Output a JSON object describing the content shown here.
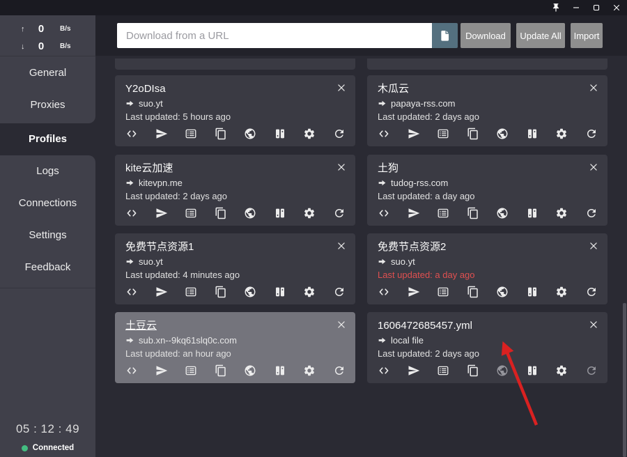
{
  "titlebar": {
    "controls": [
      "pin",
      "minimize",
      "maximize",
      "close"
    ]
  },
  "traffic": {
    "up": {
      "value": "0",
      "unit": "B/s"
    },
    "down": {
      "value": "0",
      "unit": "B/s"
    }
  },
  "toolbar": {
    "url_placeholder": "Download from a URL",
    "download_label": "Download",
    "update_all_label": "Update All",
    "import_label": "Import"
  },
  "sidebar": {
    "items": [
      "General",
      "Proxies",
      "Profiles",
      "Logs",
      "Connections",
      "Settings",
      "Feedback"
    ],
    "active_item": "Profiles",
    "timer": "05 : 12 : 49",
    "status_label": "Connected"
  },
  "profiles": [
    {
      "name": "Y2oDIsa",
      "source": "suo.yt",
      "updated": "Last updated: 5 hours ago",
      "stale": false,
      "selected": false,
      "local": false
    },
    {
      "name": "木瓜云",
      "source": "papaya-rss.com",
      "updated": "Last updated: 2 days ago",
      "stale": false,
      "selected": false,
      "local": false
    },
    {
      "name": "kite云加速",
      "source": "kitevpn.me",
      "updated": "Last updated: 2 days ago",
      "stale": false,
      "selected": false,
      "local": false
    },
    {
      "name": "土狗",
      "source": "tudog-rss.com",
      "updated": "Last updated: a day ago",
      "stale": false,
      "selected": false,
      "local": false
    },
    {
      "name": "免费节点资源1",
      "source": "suo.yt",
      "updated": "Last updated: 4 minutes ago",
      "stale": false,
      "selected": false,
      "local": false
    },
    {
      "name": "免费节点资源2",
      "source": "suo.yt",
      "updated": "Last updated: a day ago",
      "stale": true,
      "selected": false,
      "local": false
    },
    {
      "name": "土豆云",
      "source": "sub.xn--9kq61slq0c.com",
      "updated": "Last updated: an hour ago",
      "stale": false,
      "selected": true,
      "local": false
    },
    {
      "name": "1606472685457.yml",
      "source": "local file",
      "updated": "Last updated: 2 days ago",
      "stale": false,
      "selected": false,
      "local": true
    }
  ],
  "card_action_icons": [
    "code",
    "send",
    "rules",
    "copy",
    "browser",
    "switch-profile",
    "settings",
    "refresh"
  ],
  "colors": {
    "background": "#2a2a33",
    "titlebar": "#1a1a21",
    "toolbar": "#22222a",
    "sidebar_panel": "#40404a",
    "card": "#3a3a43",
    "card_selected": "#74747c",
    "paste_button": "#54707f",
    "gray_button": "#8e8e8e",
    "stale_red": "#e05050",
    "connected_green": "#43bd81",
    "annotation_red": "#d92121"
  },
  "annotation": {
    "type": "arrow",
    "target": "1606472685457.yml"
  }
}
